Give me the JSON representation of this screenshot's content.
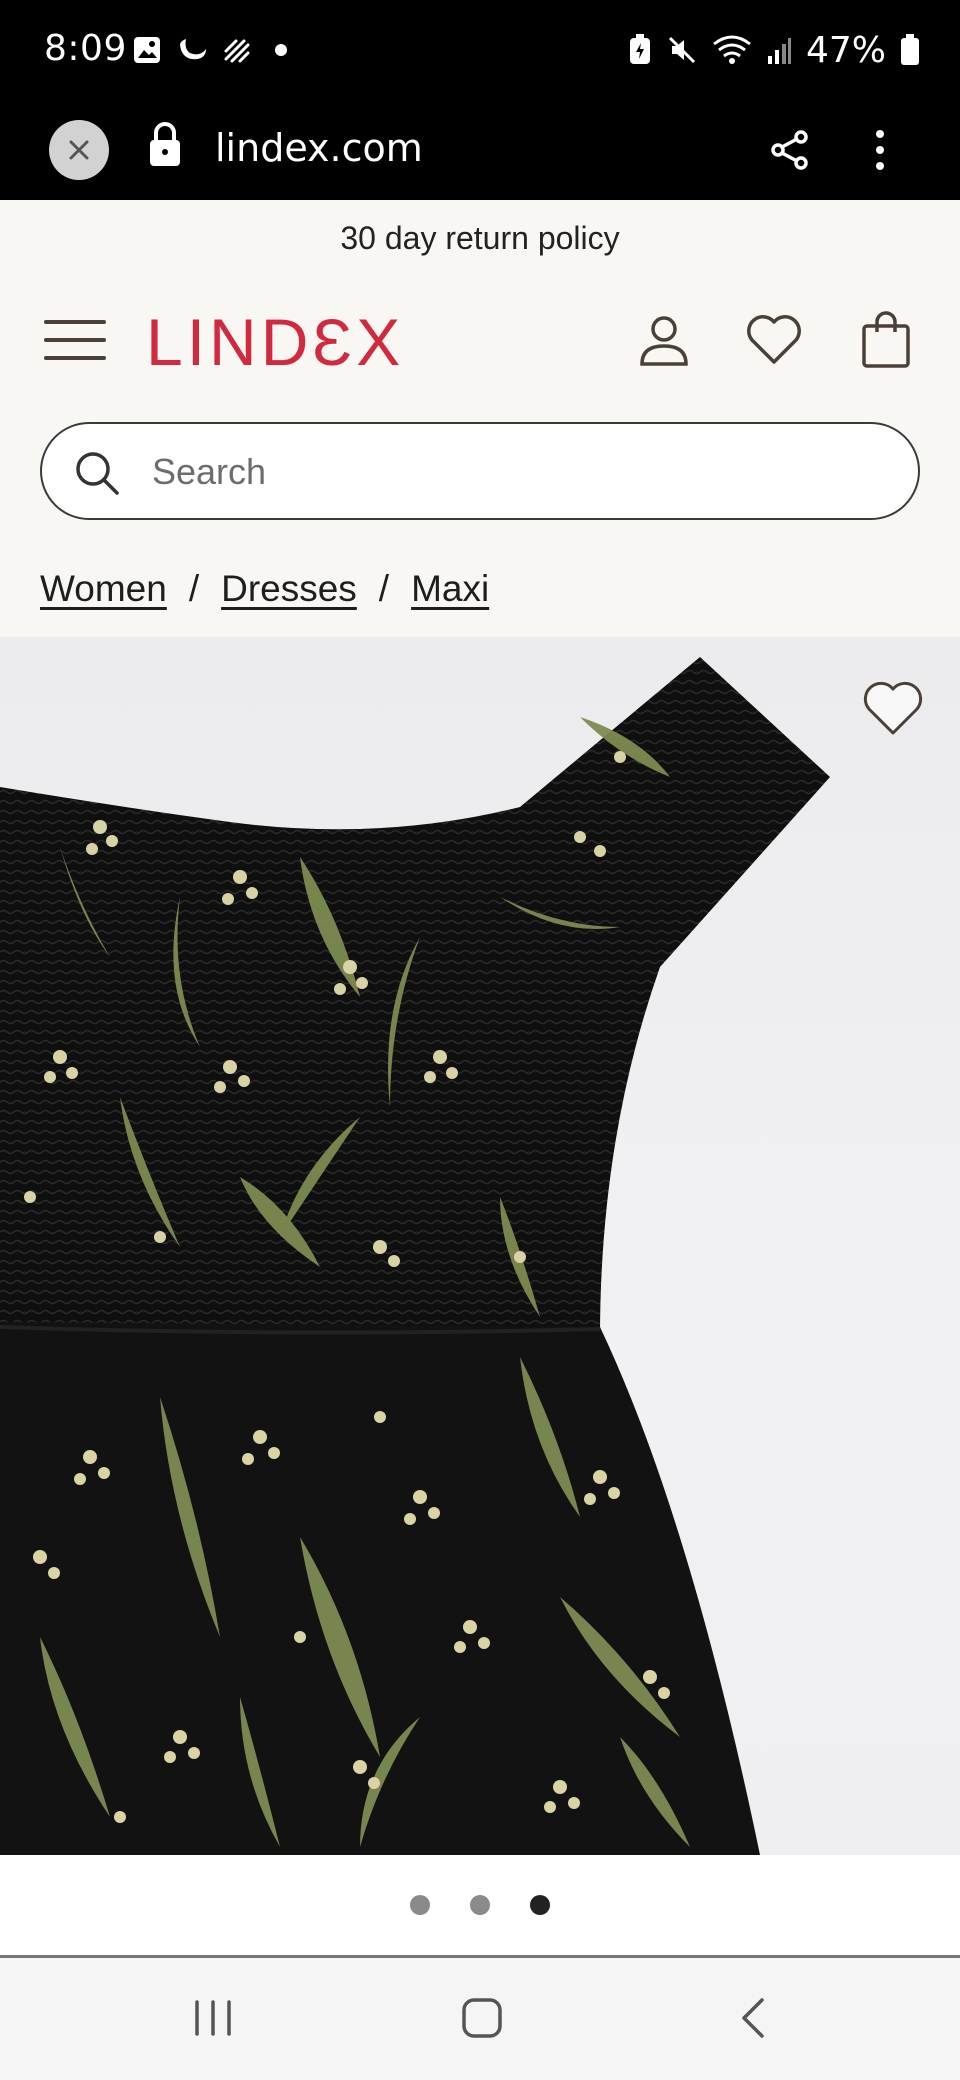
{
  "status_bar": {
    "time": "8:09",
    "battery_percent": "47%",
    "icons": [
      "gallery-icon",
      "moon-icon",
      "signal-stripes-icon",
      "dot-icon",
      "battery-saver-icon",
      "mute-icon",
      "wifi-icon",
      "cell-signal-icon",
      "battery-icon"
    ]
  },
  "browser": {
    "url": "lindex.com",
    "icons": [
      "close-icon",
      "lock-icon",
      "share-icon",
      "more-vert-icon"
    ]
  },
  "site": {
    "promo_text": "30 day return policy",
    "logo_text": "LINDƐX",
    "brand_color": "#d12a3f",
    "search": {
      "placeholder": "Search",
      "value": ""
    },
    "header_icons": [
      "menu-icon",
      "account-icon",
      "wishlist-icon",
      "bag-icon"
    ]
  },
  "breadcrumb": {
    "items": [
      {
        "label": "Women"
      },
      {
        "label": "Dresses"
      },
      {
        "label": "Maxi"
      }
    ],
    "separator": "/"
  },
  "product": {
    "image_description_icon": "favorite-icon",
    "carousel": {
      "total": 3,
      "active_index": 3
    }
  },
  "nav_bar": {
    "icons": [
      "recent-apps-icon",
      "home-icon",
      "back-icon"
    ]
  }
}
